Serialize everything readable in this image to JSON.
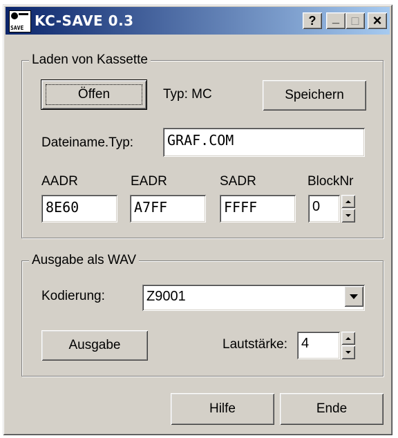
{
  "window": {
    "title": "KC-SAVE 0.3",
    "icon_text": "SAVE",
    "help_label": "?",
    "minimize_label": "_",
    "maximize_label": "□",
    "close_label": "×"
  },
  "load_group": {
    "legend": "Laden von Kassette",
    "open_label": "Öffen",
    "type_label": "Typ: MC",
    "save_label": "Speichern",
    "filename_label": "Dateiname.Typ:",
    "filename_value": "GRAF.COM",
    "aadr_label": "AADR",
    "aadr_value": "8E60",
    "eadr_label": "EADR",
    "eadr_value": "A7FF",
    "sadr_label": "SADR",
    "sadr_value": "FFFF",
    "blocknr_label": "BlockNr",
    "blocknr_value": "0"
  },
  "wav_group": {
    "legend": "Ausgabe als WAV",
    "encoding_label": "Kodierung:",
    "encoding_value": "Z9001",
    "output_label": "Ausgabe",
    "volume_label": "Lautstärke:",
    "volume_value": "4"
  },
  "footer": {
    "help_label": "Hilfe",
    "exit_label": "Ende"
  },
  "colors": {
    "title_gradient_start": "#0a246a",
    "title_gradient_end": "#a6caf0",
    "face": "#d4d0c8"
  }
}
